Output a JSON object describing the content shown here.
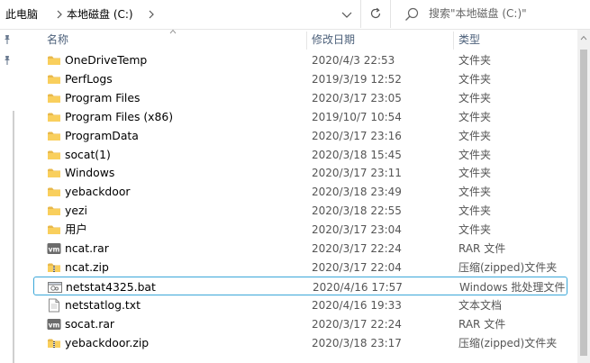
{
  "address": {
    "crumbs": [
      "此电脑",
      "本地磁盘 (C:)"
    ]
  },
  "search": {
    "placeholder": "搜索\"本地磁盘 (C:)\""
  },
  "columns": {
    "name": "名称",
    "modified": "修改日期",
    "type": "类型"
  },
  "files": [
    {
      "name": "OneDriveTemp",
      "modified": "2020/4/3 22:53",
      "type": "文件夹",
      "icon": "folder-icon"
    },
    {
      "name": "PerfLogs",
      "modified": "2019/3/19 12:52",
      "type": "文件夹",
      "icon": "folder-icon"
    },
    {
      "name": "Program Files",
      "modified": "2020/3/17 23:05",
      "type": "文件夹",
      "icon": "folder-icon"
    },
    {
      "name": "Program Files (x86)",
      "modified": "2019/10/7 10:54",
      "type": "文件夹",
      "icon": "folder-icon"
    },
    {
      "name": "ProgramData",
      "modified": "2020/3/17 23:16",
      "type": "文件夹",
      "icon": "folder-icon"
    },
    {
      "name": "socat(1)",
      "modified": "2020/3/18 15:45",
      "type": "文件夹",
      "icon": "folder-icon"
    },
    {
      "name": "Windows",
      "modified": "2020/3/17 23:11",
      "type": "文件夹",
      "icon": "folder-icon"
    },
    {
      "name": "yebackdoor",
      "modified": "2020/3/18 23:49",
      "type": "文件夹",
      "icon": "folder-icon"
    },
    {
      "name": "yezi",
      "modified": "2020/3/18 22:55",
      "type": "文件夹",
      "icon": "folder-icon"
    },
    {
      "name": "用户",
      "modified": "2020/3/17 23:04",
      "type": "文件夹",
      "icon": "folder-icon"
    },
    {
      "name": "ncat.rar",
      "modified": "2020/3/17 22:24",
      "type": "RAR 文件",
      "icon": "vm-archive-icon"
    },
    {
      "name": "ncat.zip",
      "modified": "2020/3/17 22:04",
      "type": "压缩(zipped)文件夹",
      "icon": "zip-folder-icon"
    },
    {
      "name": "netstat4325.bat",
      "modified": "2020/4/16 17:57",
      "type": "Windows 批处理文件",
      "icon": "batch-file-icon",
      "selected": true
    },
    {
      "name": "netstatlog.txt",
      "modified": "2020/4/16 19:33",
      "type": "文本文档",
      "icon": "text-file-icon"
    },
    {
      "name": "socat.rar",
      "modified": "2020/3/17 22:24",
      "type": "RAR 文件",
      "icon": "vm-archive-icon"
    },
    {
      "name": "yebackdoor.zip",
      "modified": "2020/3/18 23:17",
      "type": "压缩(zipped)文件夹",
      "icon": "zip-folder-icon"
    }
  ]
}
